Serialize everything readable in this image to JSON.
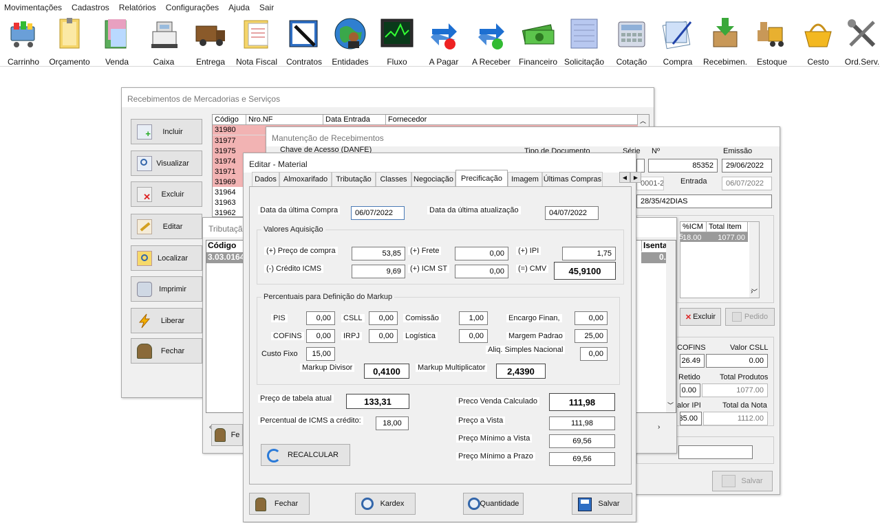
{
  "menu": [
    "Movimentações",
    "Cadastros",
    "Relatórios",
    "Configurações",
    "Ajuda",
    "Sair"
  ],
  "toolbar": [
    "Carrinho",
    "Orçamento",
    "Venda",
    "Caixa",
    "Entrega",
    "Nota Fiscal",
    "Contratos",
    "Entidades",
    "Fluxo",
    "A Pagar",
    "A Receber",
    "Financeiro",
    "Solicitação",
    "Cotação",
    "Compra",
    "Recebimen.",
    "Estoque",
    "Cesto",
    "Ord.Serv."
  ],
  "receb_list": {
    "title": "Recebimentos de Mercadorias e Serviços",
    "buttons": [
      "Incluir",
      "Visualizar",
      "Excluir",
      "Editar",
      "Localizar",
      "Imprimir",
      "Liberar",
      "Fechar"
    ],
    "columns": [
      "Código",
      "Nro.NF",
      "Data Entrada",
      "Fornecedor"
    ],
    "rows": [
      "31980",
      "31977",
      "31975",
      "31974",
      "31971",
      "31969",
      "31964",
      "31963",
      "31962"
    ],
    "row1_nf_partial": "6"
  },
  "manut": {
    "title": "Manutenção de Recebimentos",
    "chave_label": "Chave de Acesso (DANFE)",
    "tipo_label": "Tipo de Documento",
    "serie_label": "Série",
    "numero_label": "Nº",
    "emissao_label": "Emissão",
    "numero": "85352",
    "emissao": "29/06/2022",
    "fornecedor_partial": "0001-23",
    "entrada_label": "Entrada",
    "entrada": "06/07/2022",
    "cond_pag": "28/35/42DIAS",
    "grid_cols": [
      "%ICM",
      "Total Item"
    ],
    "grid_row": [
      "18.00",
      "1077.00"
    ],
    "grid_partial": "5",
    "excluir": "Excluir",
    "pedido": "Pedido",
    "cofins_label": "COFINS",
    "cofins": "26.49",
    "csll_label": "Valor CSLL",
    "csll": "0.00",
    "retido_label": "Retido",
    "retido": "0.00",
    "total_prod_label": "Total Produtos",
    "total_prod": "1077.00",
    "ipi_label": "alor IPI",
    "ipi": "35.00",
    "total_nota_label": "Total da Nota",
    "total_nota": "1112.00",
    "recalcular_partial": "ecalcular",
    "salvar": "Salvar"
  },
  "tribut": {
    "title": "Tributação",
    "col_codigo": "Código",
    "col_isenta": "Isenta",
    "row_codigo": "3.03.0164",
    "row_isenta": "0.",
    "fechar_partial": "Fe"
  },
  "editar": {
    "title": "Editar - Material",
    "tabs": [
      "Dados",
      "Almoxarifado",
      "Tributação",
      "Classes",
      "Negociação",
      "Precificação",
      "Imagem",
      "Últimas Compras"
    ],
    "active_tab": "Precificação",
    "data_ult_compra_label": "Data da última Compra",
    "data_ult_compra": "06/07/2022",
    "data_ult_atual_label": "Data da última atualização",
    "data_ult_atual": "04/07/2022",
    "valores_group": "Valores Aquisição",
    "preco_compra_label": "(+) Preço de compra",
    "preco_compra": "53,85",
    "frete_label": "(+) Frete",
    "frete": "0,00",
    "ipi_label": "(+) IPI",
    "ipi": "1,75",
    "credito_icms_label": "(-) Crédito ICMS",
    "credito_icms": "9,69",
    "icm_st_label": "(+) ICM ST",
    "icm_st": "0,00",
    "cmv_label": "(=) CMV",
    "cmv": "45,9100",
    "markup_group": "Percentuais para Definição do Markup",
    "pis_label": "PIS",
    "pis": "0,00",
    "csll_label": "CSLL",
    "csll": "0,00",
    "comissao_label": "Comissão",
    "comissao": "1,00",
    "encargo_label": "Encargo Finan,",
    "encargo": "0,00",
    "cofins_label": "COFINS",
    "cofins": "0,00",
    "irpj_label": "IRPJ",
    "irpj": "0,00",
    "logistica_label": "Logística",
    "logistica": "0,00",
    "margem_label": "Margem Padrao",
    "margem": "25,00",
    "custo_fixo_label": "Custo Fixo",
    "custo_fixo": "15,00",
    "aliq_label": "Aliq. Simples Nacional",
    "aliq": "0,00",
    "markup_div_label": "Markup Divisor",
    "markup_div": "0,4100",
    "markup_mult_label": "Markup Multiplicator",
    "markup_mult": "2,4390",
    "preco_tabela_label": "Preço de tabela atual",
    "preco_tabela": "133,31",
    "perc_icms_label": "Percentual de ICMS a crédito:",
    "perc_icms": "18,00",
    "preco_venda_label": "Preco Venda Calculado",
    "preco_venda": "111,98",
    "preco_vista_label": "Preço a Vista",
    "preco_vista": "111,98",
    "preco_min_vista_label": "Preço Mínimo a Vista",
    "preco_min_vista": "69,56",
    "preco_min_prazo_label": "Preço Mínimo a Prazo",
    "preco_min_prazo": "69,56",
    "recalcular": "RECALCULAR",
    "fechar": "Fechar",
    "kardex": "Kardex",
    "quantidade": "Quantidade",
    "salvar": "Salvar"
  },
  "colors": {
    "pink_row": "#f2b3b3",
    "selected_row": "#9a9a9a",
    "toolbar_bg": "#ffffff"
  }
}
